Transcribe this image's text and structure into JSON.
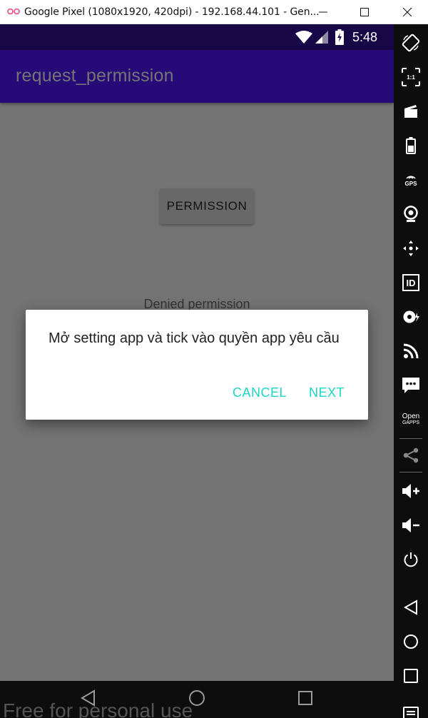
{
  "window": {
    "title": "Google Pixel (1080x1920, 420dpi) - 192.168.44.101 - Gen...",
    "minimize_icon": "minimize-icon",
    "maximize_icon": "maximize-icon",
    "close_icon": "close-icon"
  },
  "statusbar": {
    "time": "5:48",
    "icons": [
      "wifi-icon",
      "cell-signal-icon",
      "battery-charging-icon"
    ]
  },
  "app": {
    "title": "request_permission",
    "permission_button": "PERMISSION",
    "status_text": "Denied permission"
  },
  "dialog": {
    "message": "Mở setting app và tick vào quyền app yêu cầu",
    "cancel_label": "CANCEL",
    "next_label": "NEXT"
  },
  "navbar": {
    "icons": [
      "back-icon",
      "home-icon",
      "recents-icon"
    ]
  },
  "watermark": "Free for personal use",
  "sidebar": {
    "gps_label": "GPS",
    "id_label": "ID",
    "open_gapps_label_1": "Open",
    "open_gapps_label_2": "GAPPS",
    "pixel_perfect_label": "1:1"
  },
  "colors": {
    "statusbar": "#170746",
    "appbar": "#260a77",
    "accent": "#1ad6c4",
    "scrim": "#737373"
  }
}
